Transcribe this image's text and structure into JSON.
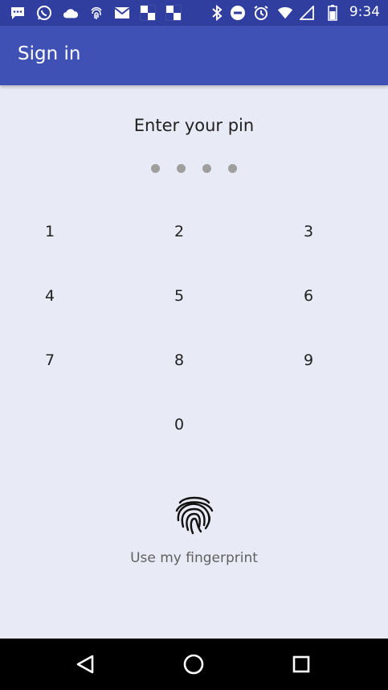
{
  "status_bar": {
    "time": "9:34",
    "left_icons": [
      "chat-bubble-icon",
      "whatsapp-icon",
      "cloud-icon",
      "fingerprint-icon",
      "mail-icon",
      "chess-icon",
      "chess-icon"
    ],
    "right_icons": [
      "bluetooth-icon",
      "do-not-disturb-icon",
      "alarm-icon",
      "wifi-icon",
      "signal-icon",
      "battery-icon"
    ]
  },
  "app_bar": {
    "title": "Sign in",
    "color": "#3f51b5",
    "status_color": "#303f9f"
  },
  "pin": {
    "prompt": "Enter your pin",
    "dot_count": 4
  },
  "keypad": {
    "keys": [
      "1",
      "2",
      "3",
      "4",
      "5",
      "6",
      "7",
      "8",
      "9",
      "0"
    ]
  },
  "fingerprint": {
    "icon": "fingerprint-icon",
    "label": "Use my fingerprint"
  },
  "nav_bar": {
    "buttons": [
      "back-icon",
      "home-icon",
      "recents-icon"
    ]
  }
}
